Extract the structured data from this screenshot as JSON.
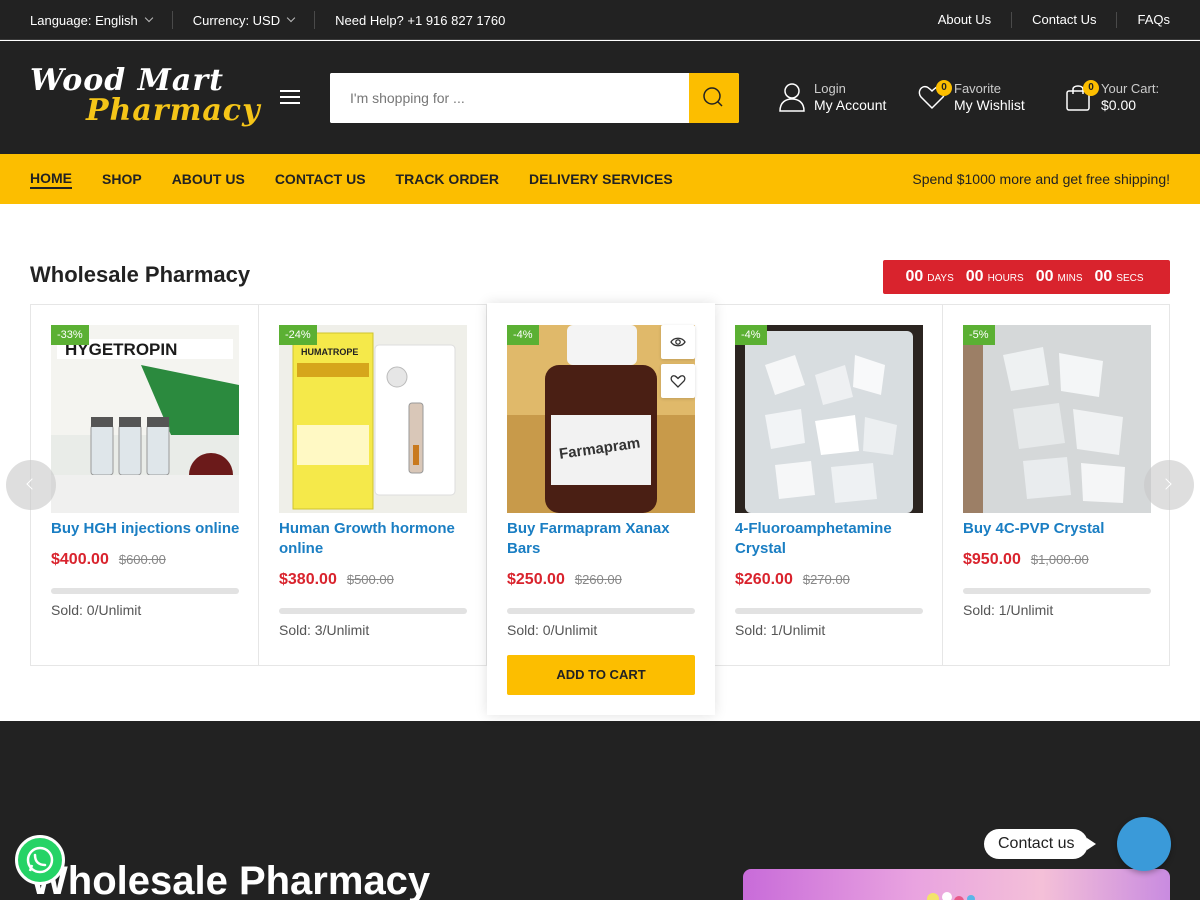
{
  "topbar": {
    "language": "Language: English",
    "currency": "Currency: USD",
    "help": "Need Help? +1 916 827 1760",
    "links": [
      "About Us",
      "Contact Us",
      "FAQs"
    ]
  },
  "header": {
    "logo_line1": "Wood Mart",
    "logo_line2": "Pharmacy",
    "search_placeholder": "I'm shopping for ...",
    "account_small": "Login",
    "account_big": "My Account",
    "wishlist_small": "Favorite",
    "wishlist_big": "My Wishlist",
    "wishlist_count": "0",
    "cart_small": "Your Cart:",
    "cart_big": "$0.00",
    "cart_count": "0"
  },
  "nav": {
    "items": [
      "HOME",
      "SHOP",
      "ABOUT US",
      "CONTACT US",
      "TRACK ORDER",
      "DELIVERY SERVICES"
    ],
    "promo": "Spend $1000 more and get free shipping!"
  },
  "section": {
    "title": "Wholesale Pharmacy",
    "countdown": [
      {
        "n": "00",
        "u": "DAYS"
      },
      {
        "n": "00",
        "u": "HOURS"
      },
      {
        "n": "00",
        "u": "MINS"
      },
      {
        "n": "00",
        "u": "SECS"
      }
    ]
  },
  "products": [
    {
      "discount": "-33%",
      "name": "Buy HGH injections online",
      "price": "$400.00",
      "old": "$600.00",
      "sold": "Sold: 0/Unlimit",
      "sold_fraction": 0
    },
    {
      "discount": "-24%",
      "name": "Human Growth hormone online",
      "price": "$380.00",
      "old": "$500.00",
      "sold": "Sold: 3/Unlimit",
      "sold_fraction": 0
    },
    {
      "discount": "-4%",
      "name": "Buy Farmapram Xanax Bars",
      "price": "$250.00",
      "old": "$260.00",
      "sold": "Sold: 0/Unlimit",
      "sold_fraction": 0,
      "add_to_cart": "ADD TO CART"
    },
    {
      "discount": "-4%",
      "name": "4-Fluoroamphetamine Crystal",
      "price": "$260.00",
      "old": "$270.00",
      "sold": "Sold: 1/Unlimit",
      "sold_fraction": 0
    },
    {
      "discount": "-5%",
      "name": "Buy 4C-PVP Crystal",
      "price": "$950.00",
      "old": "$1,000.00",
      "sold": "Sold: 1/Unlimit",
      "sold_fraction": 0
    }
  ],
  "footer": {
    "heading": "Wholesale Pharmacy",
    "contact_label": "Contact us"
  },
  "colors": {
    "accent": "#fcbe00",
    "dark": "#222222",
    "link": "#1a7ec3",
    "price": "#d9232d",
    "discount": "#5bb033",
    "countdown": "#d9232d"
  },
  "icons": [
    "chevron-down-icon",
    "menu-icon",
    "search-icon",
    "user-icon",
    "heart-icon",
    "cart-icon",
    "eye-icon",
    "chevron-left-icon",
    "chevron-right-icon",
    "whatsapp-icon",
    "chat-icon"
  ]
}
